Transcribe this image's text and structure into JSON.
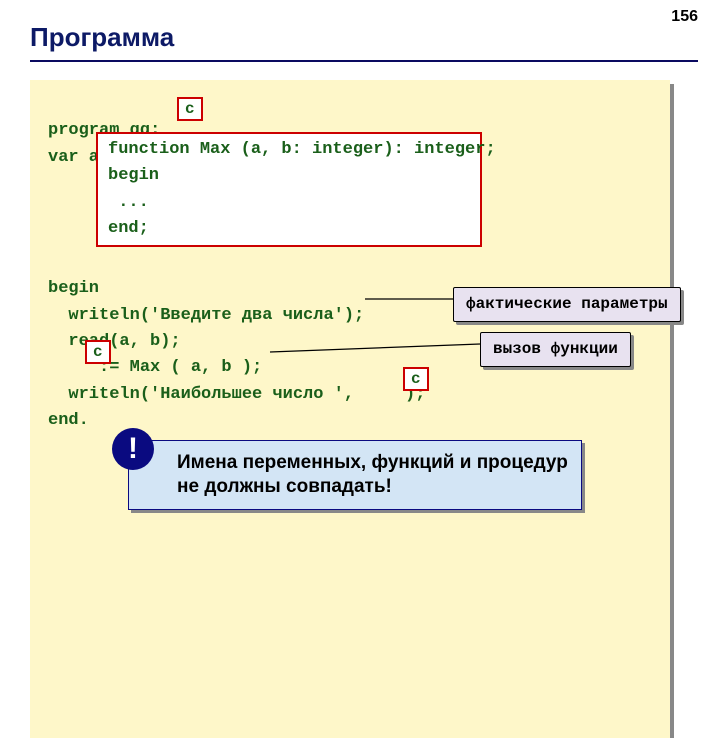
{
  "page_number": "156",
  "title": "Программа",
  "code": {
    "l1": "program qq;",
    "l2": "var a, b,     : integer;",
    "l7": "begin",
    "l8": "  writeln('Введите два числа');",
    "l9": "  read(a, b);",
    "l10": "     := Max ( a, b );",
    "l11": "  writeln('Наибольшее число ',     );",
    "l12": "end."
  },
  "func_box": {
    "f1": "function Max (a, b: integer): integer;",
    "f2": "begin",
    "f3": " ...",
    "f4": "end;"
  },
  "badges": {
    "c": "c"
  },
  "callouts": {
    "actual_params": "фактические параметры",
    "func_call": "вызов функции"
  },
  "note": {
    "excl": "!",
    "text": "Имена переменных, функций и процедур не должны совпадать!"
  }
}
